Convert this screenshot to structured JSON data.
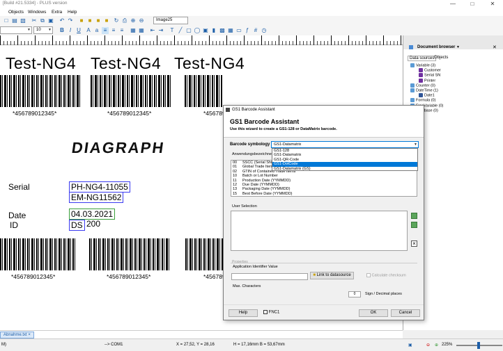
{
  "window": {
    "title": "[Build #21.5334] - PLUS version"
  },
  "menu": [
    "Objects",
    "Windows",
    "Extra",
    "Help"
  ],
  "toolbar": {
    "font_size": "10",
    "object_name": "Image25"
  },
  "canvas": {
    "titles": [
      "Test-NG4",
      "Test-NG4",
      "Test-NG4"
    ],
    "barcode_text": "*456789012345*",
    "logo": "DIAGRAPH",
    "serial_label": "Serial",
    "serial_values": [
      "PH-NG4-11055",
      "EM-NG11562"
    ],
    "date_label": "Date",
    "date_value": "04.03.2021",
    "id_label": "ID",
    "id_prefix": "DS",
    "id_value": "200"
  },
  "doc_browser": {
    "title": "Document browser",
    "tabs": [
      "Data sources",
      "Objects"
    ],
    "tree": [
      {
        "label": "Variable (3)",
        "level": 1,
        "color": "#5b9bd5"
      },
      {
        "label": "Customer",
        "level": 2,
        "color": "#7030a0"
      },
      {
        "label": "Serial SN",
        "level": 2,
        "color": "#7030a0"
      },
      {
        "label": "Printer",
        "level": 2,
        "color": "#7030a0"
      },
      {
        "label": "Counter (0)",
        "level": 1,
        "color": "#5b9bd5"
      },
      {
        "label": "DateTime (1)",
        "level": 1,
        "color": "#5b9bd5"
      },
      {
        "label": "Date1",
        "level": 2,
        "color": "#2f5597"
      },
      {
        "label": "Formula (0)",
        "level": 1,
        "color": "#5b9bd5"
      },
      {
        "label": "FreeVariable (0)",
        "level": 1,
        "color": "#5b9bd5"
      },
      {
        "label": "Database (0)",
        "level": 1,
        "color": "#5b9bd5"
      }
    ]
  },
  "tabs": {
    "file": "Abnahme.txt"
  },
  "status": {
    "left": "M)",
    "port": "--> COM1",
    "coords": "X = 27,52, Y = 28,16",
    "size": "H = 17,16mm  B = 53,67mm",
    "zoom": "225%"
  },
  "dialog": {
    "title": "GS1 Barcode Assistant",
    "heading": "GS1 Barcode Assistant",
    "subheading": "Use this wizard to create a GS1-128 or DataMatrix barcode.",
    "symbology_label": "Barcode symbology",
    "symbology_value": "GS1-Datamatrix",
    "symbology_options": [
      "GS1-128",
      "GS1-Datamatrix",
      "GS1-QR-Code",
      "GS1-DotCode",
      "GS1-Datamatrix (GS)"
    ],
    "selected_option": "GS1-DotCode",
    "ai_label": "Anwendungsbezeichner",
    "ai_rows": [
      [
        "00",
        "SSCC (Serial Shipping Container Code)"
      ],
      [
        "01",
        "Global Trade Item Number (GTIN)"
      ],
      [
        "02",
        "GTIN of Contained Trade Items"
      ],
      [
        "10",
        "Batch or Lot Number"
      ],
      [
        "11",
        "Production Date (YYMMDD)"
      ],
      [
        "12",
        "Due Date (YYMMDD)"
      ],
      [
        "13",
        "Packaging Date (YYMMDD)"
      ],
      [
        "15",
        "Best Before Date (YYMMDD)"
      ]
    ],
    "user_selection_label": "User Selection",
    "properties_label": "Properties",
    "ai_value_label": "Application Identifier Value",
    "link_button": "Link to datasource",
    "calc_checksum": "Calculate checksum",
    "max_chars_label": "Max. Characters",
    "decimal_value": "0",
    "decimal_label": "Sign / Decimal places",
    "help_button": "Help",
    "fnc1_label": "FNC1",
    "ok_button": "OK",
    "cancel_button": "Cancel"
  }
}
